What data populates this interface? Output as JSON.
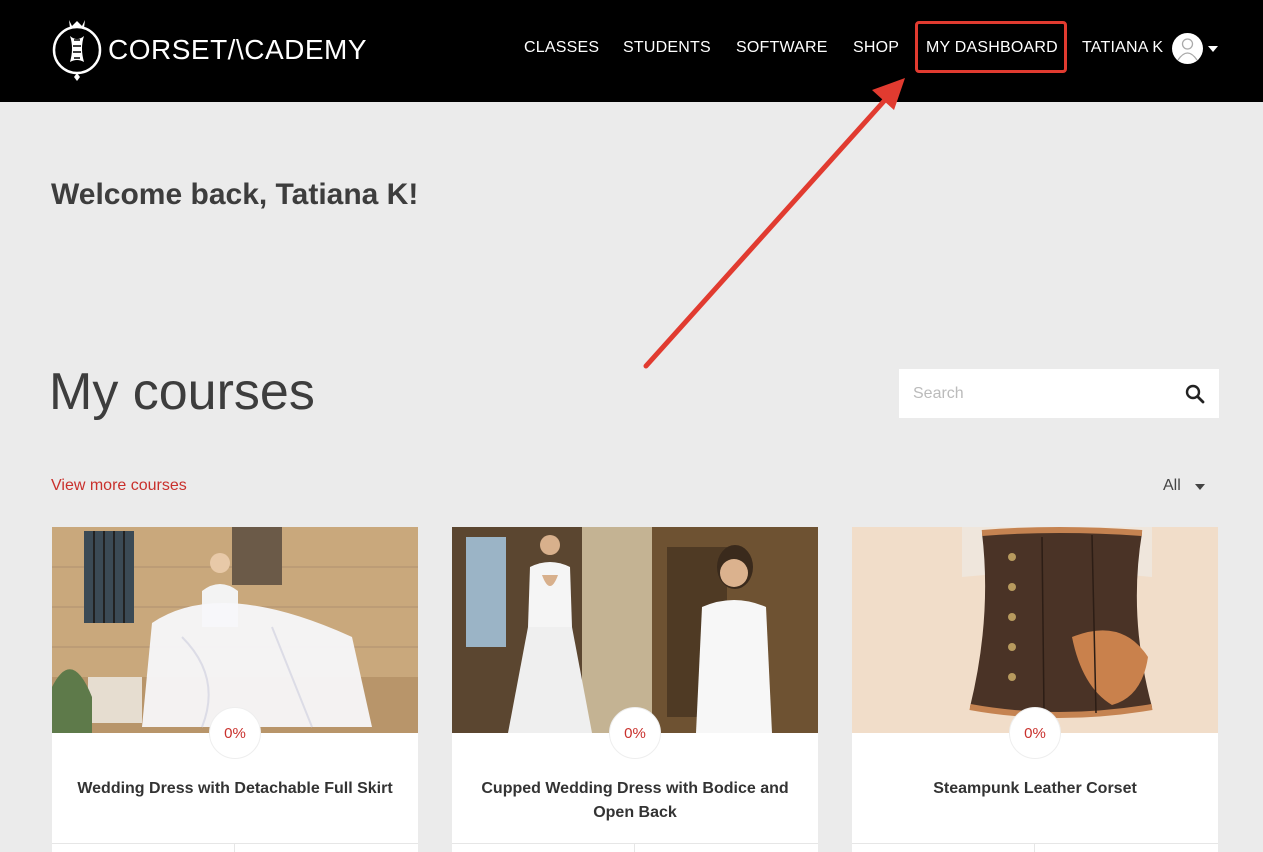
{
  "header": {
    "brand": "CORSET/\\CADEMY",
    "nav": [
      "CLASSES",
      "STUDENTS",
      "SOFTWARE",
      "SHOP",
      "MY DASHBOARD"
    ],
    "user_name": "TATIANA K"
  },
  "welcome": "Welcome back, Tatiana K!",
  "courses": {
    "title": "My courses",
    "search_placeholder": "Search",
    "more_link": "View more courses",
    "filter_value": "All",
    "items": [
      {
        "title": "Wedding Dress with Detachable Full Skirt",
        "progress": "0%"
      },
      {
        "title": "Cupped Wedding Dress with Bodice and Open Back",
        "progress": "0%"
      },
      {
        "title": "Steampunk Leather Corset",
        "progress": "0%"
      }
    ]
  },
  "colors": {
    "accent": "#c9302c",
    "header_bg": "#000000",
    "highlight": "#e13b30"
  }
}
